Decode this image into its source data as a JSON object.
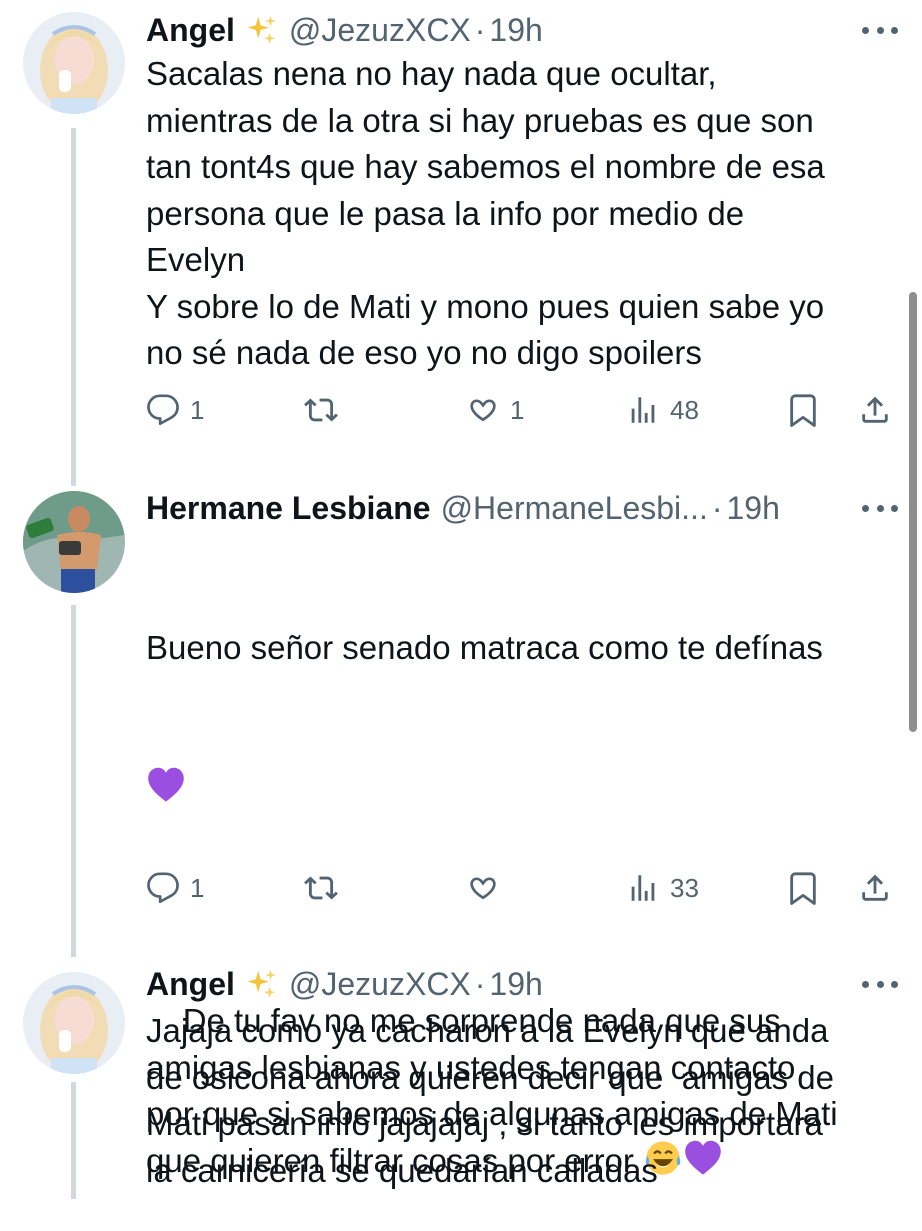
{
  "tweets": [
    {
      "author": "Angel",
      "handle": "@JezuzXCX",
      "time": "19h",
      "text": "Sacalas nena no hay nada que ocultar,\nmientras de la otra si hay pruebas es que son\ntan tont4s que hay sabemos el nombre de esa\npersona que le pasa la info por medio de\nEvelyn\nY sobre lo de Mati y mono pues quien sabe yo\nno sé nada de eso yo no digo spoilers",
      "replies": "1",
      "retweets": "",
      "likes": "1",
      "views": "48",
      "avatar_icon": "avatar-blonde-woman"
    },
    {
      "author": "Hermane Lesbiane",
      "handle": "@HermaneLesbi...",
      "time": "19h",
      "text_line1": "Bueno señor senado matraca como te defínas",
      "text_rest": "De tu fav no me sorprende nada que sus\namigas lesbianas y ustedes tengan contacto\npor que si sabemos de algunas amigas de Mati\nque quieren filtrar cosas por error",
      "replies": "1",
      "retweets": "",
      "likes": "",
      "views": "33",
      "avatar_icon": "avatar-shirtless-man-exatlon"
    },
    {
      "author": "Angel",
      "handle": "@JezuzXCX",
      "time": "19h",
      "text": "Jajaja como ya cacharon a la Evelyn que anda\nde osicona ahora quieren decir que  amigas de\nMati pasan info jajajajaj , si tanto les importara\nla carnicería se quedarían calladas",
      "avatar_icon": "avatar-blonde-woman"
    }
  ],
  "colors": {
    "text": "#0f1419",
    "muted": "#536471",
    "thread_line": "#cfd9de",
    "purple_heart": "#9b4fe0"
  },
  "icons": [
    "sparkles-icon",
    "more-icon",
    "reply-icon",
    "retweet-icon",
    "like-icon",
    "views-icon",
    "bookmark-icon",
    "share-icon",
    "purple-heart-emoji",
    "tears-of-joy-emoji"
  ]
}
